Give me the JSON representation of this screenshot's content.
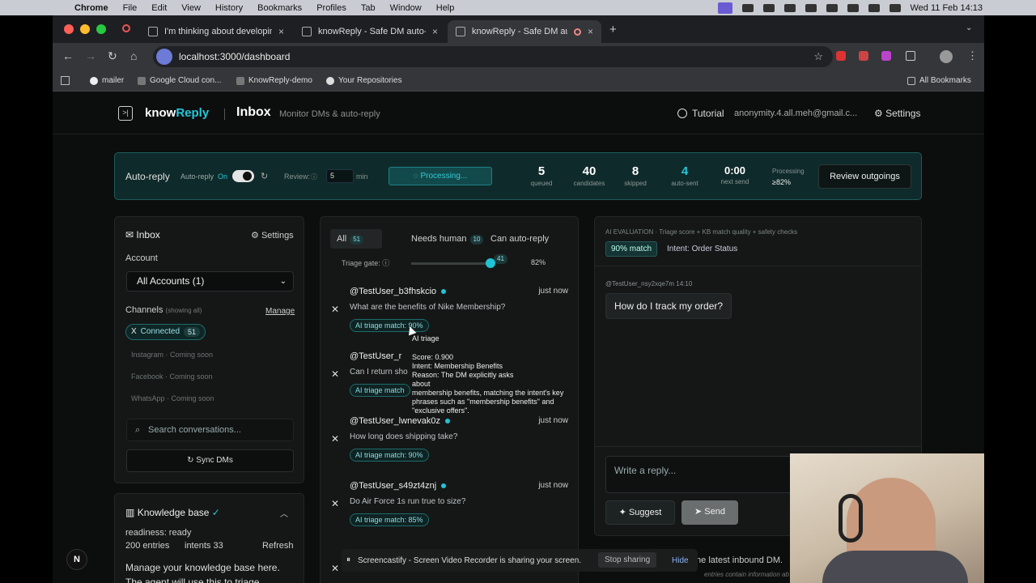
{
  "mac_menu": {
    "app": "Chrome",
    "items": [
      "File",
      "Edit",
      "View",
      "History",
      "Bookmarks",
      "Profiles",
      "Tab",
      "Window",
      "Help"
    ],
    "clock": "Wed 11 Feb  14:13"
  },
  "browser": {
    "tabs": [
      {
        "label": "I'm thinking about developing a"
      },
      {
        "label": "knowReply - Safe DM auto-rep"
      },
      {
        "label": "knowReply - Safe DM auto-r"
      }
    ],
    "url": "localhost:3000/dashboard",
    "bookmarks": [
      "mailer",
      "Google Cloud con...",
      "KnowReply-demo",
      "Your Repositories"
    ],
    "all_bookmarks": "All Bookmarks"
  },
  "header": {
    "brand_a": "know",
    "brand_b": "Reply",
    "title": "Inbox",
    "subtitle": "Monitor DMs & auto-reply",
    "tutorial": "Tutorial",
    "email": "anonymity.4.all.meh@gmail.c...",
    "settings": "Settings"
  },
  "autoreply": {
    "label": "Auto-reply",
    "toggle_label": "Auto-reply",
    "toggle_state": "On",
    "review_label": "Review:",
    "review_value": "5",
    "review_unit": "min",
    "processing": "Processing...",
    "stats": [
      {
        "value": "5",
        "label": "queued"
      },
      {
        "value": "40",
        "label": "candidates"
      },
      {
        "value": "8",
        "label": "skipped"
      },
      {
        "value": "4",
        "label": "auto-sent"
      },
      {
        "value": "0:00",
        "label": "next send"
      }
    ],
    "proc_label": "Processing",
    "proc_value": "≥82%",
    "review_btn": "Review outgoings"
  },
  "sidebar": {
    "title": "Inbox",
    "settings": "Settings",
    "account_label": "Account",
    "account_value": "All Accounts (1)",
    "channels_label": "Channels",
    "channels_hint": "(showing all)",
    "manage": "Manage",
    "connected": {
      "prefix": "X",
      "label": "Connected",
      "count": "51"
    },
    "soon": [
      {
        "name": "Instagram",
        "status": "Coming soon"
      },
      {
        "name": "Facebook",
        "status": "Coming soon"
      },
      {
        "name": "WhatsApp",
        "status": "Coming soon"
      }
    ],
    "search_placeholder": "Search conversations...",
    "sync": "Sync DMs"
  },
  "kb": {
    "title": "Knowledge base",
    "readiness": "readiness: ready",
    "entries": "200 entries",
    "intents": "intents 33",
    "refresh": "Refresh",
    "text1": "Manage your knowledge base here.",
    "text2": "The agent will use this to triage"
  },
  "list": {
    "tabs": [
      {
        "label": "All",
        "count": "51"
      },
      {
        "label": "Needs human",
        "count": "10"
      },
      {
        "label": "Can auto-reply",
        "count": "41"
      }
    ],
    "gate_label": "Triage gate:",
    "gate_value": "82%",
    "items": [
      {
        "user": "@TestUser_b3fhskcio",
        "time": "just now",
        "msg": "What are the benefits of Nike Membership?",
        "triage": "AI triage match: 90%"
      },
      {
        "user": "@TestUser_r",
        "time": "",
        "msg": "Can I return sho",
        "triage": "AI triage match"
      },
      {
        "user": "@TestUser_lwnevak0z",
        "time": "just now",
        "msg": "How long does shipping take?",
        "triage": "AI triage match: 90%"
      },
      {
        "user": "@TestUser_s49zt4znj",
        "time": "just now",
        "msg": "Do Air Force 1s run true to size?",
        "triage": "AI triage match: 85%"
      }
    ]
  },
  "tooltip": {
    "title": "AI triage",
    "lines": [
      "Score: 0.900",
      "Intent: Membership Benefits",
      "Reason: The DM explicitly asks about",
      "membership benefits, matching the intent's key",
      "phrases such as \"membership benefits\" and",
      "\"exclusive offers\"."
    ]
  },
  "eval": {
    "header": "AI EVALUATION",
    "header_sub": "· Triage score + KB match quality + safety checks",
    "match": "90% match",
    "intent": "Intent: Order Status",
    "msg_user": "@TestUser_nsy2xqe7m",
    "msg_time": "14:10",
    "msg_text": "How do I track my order?",
    "reply_placeholder": "Write a reply...",
    "suggest": "Suggest",
    "send": "Send",
    "footer": "the latest inbound DM.",
    "footer2": "entries contain information ab"
  },
  "share_bar": {
    "text": "Screencastify - Screen Video Recorder is sharing your screen.",
    "stop": "Stop sharing",
    "hide": "Hide"
  },
  "colors": {
    "accent": "#22c3d3",
    "bg": "#0c0d0d",
    "panel": "#151717"
  }
}
